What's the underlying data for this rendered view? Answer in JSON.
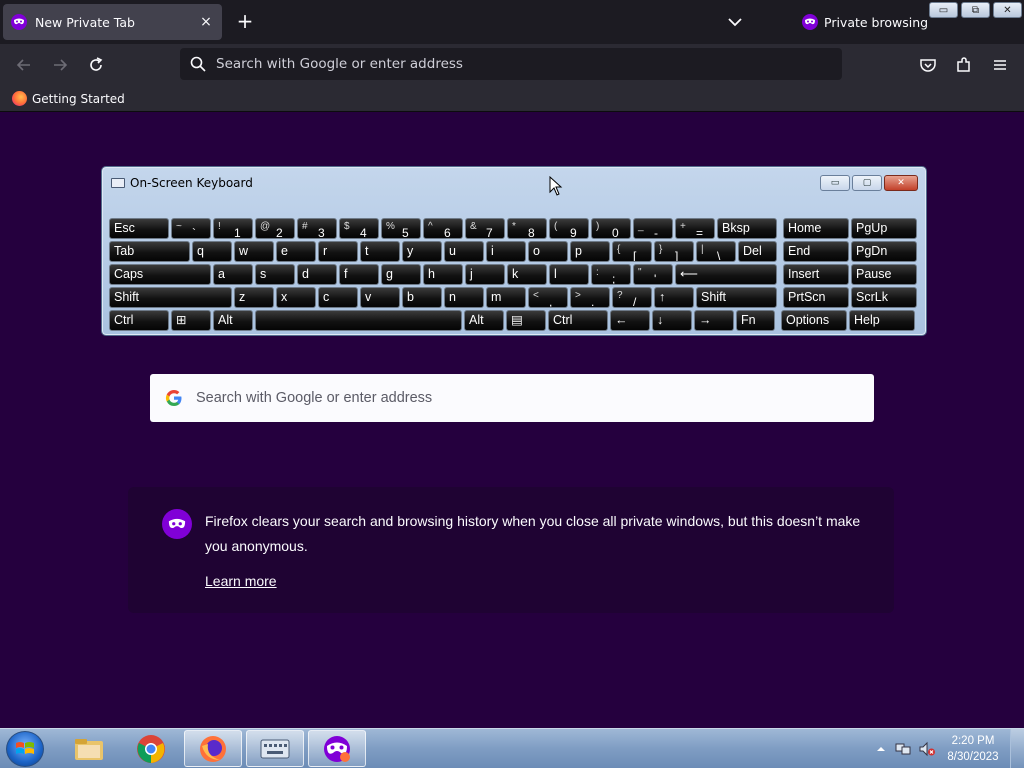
{
  "browser": {
    "tab": {
      "title": "New Private Tab",
      "close": "×"
    },
    "new_tab": "+",
    "private_label": "Private browsing",
    "window_controls": {
      "minimize": "▭",
      "restore": "⧉",
      "close": "✕"
    },
    "urlbar": {
      "placeholder": "Search with Google or enter address"
    },
    "bookmarks": [
      {
        "label": "Getting Started"
      }
    ]
  },
  "osk": {
    "title": "On-Screen Keyboard",
    "controls": {
      "minimize": "▭",
      "maximize": "▢",
      "close": "✕"
    },
    "rows": [
      [
        {
          "t": "",
          "b": "Esc",
          "w": 60
        },
        {
          "t": "~",
          "b": "`",
          "w": 40
        },
        {
          "t": "!",
          "b": "1",
          "w": 40
        },
        {
          "t": "@",
          "b": "2",
          "w": 40
        },
        {
          "t": "#",
          "b": "3",
          "w": 40
        },
        {
          "t": "$",
          "b": "4",
          "w": 40
        },
        {
          "t": "%",
          "b": "5",
          "w": 40
        },
        {
          "t": "^",
          "b": "6",
          "w": 40
        },
        {
          "t": "&",
          "b": "7",
          "w": 40
        },
        {
          "t": "*",
          "b": "8",
          "w": 40
        },
        {
          "t": "(",
          "b": "9",
          "w": 40
        },
        {
          "t": ")",
          "b": "0",
          "w": 40
        },
        {
          "t": "_",
          "b": "-",
          "w": 40
        },
        {
          "t": "+",
          "b": "=",
          "w": 40
        },
        {
          "t": "",
          "b": "Bksp",
          "w": 60
        },
        {
          "t": "",
          "b": "Home",
          "w": 66
        },
        {
          "t": "",
          "b": "PgUp",
          "w": 66
        }
      ],
      [
        {
          "t": "",
          "b": "Tab",
          "w": 81
        },
        {
          "t": "",
          "b": "q",
          "w": 40
        },
        {
          "t": "",
          "b": "w",
          "w": 40
        },
        {
          "t": "",
          "b": "e",
          "w": 40
        },
        {
          "t": "",
          "b": "r",
          "w": 40
        },
        {
          "t": "",
          "b": "t",
          "w": 40
        },
        {
          "t": "",
          "b": "y",
          "w": 40
        },
        {
          "t": "",
          "b": "u",
          "w": 40
        },
        {
          "t": "",
          "b": "i",
          "w": 40
        },
        {
          "t": "",
          "b": "o",
          "w": 40
        },
        {
          "t": "",
          "b": "p",
          "w": 40
        },
        {
          "t": "{",
          "b": "[",
          "w": 40
        },
        {
          "t": "}",
          "b": "]",
          "w": 40
        },
        {
          "t": "|",
          "b": "\\",
          "w": 40
        },
        {
          "t": "",
          "b": "Del",
          "w": 39
        },
        {
          "t": "",
          "b": "End",
          "w": 66
        },
        {
          "t": "",
          "b": "PgDn",
          "w": 66
        }
      ],
      [
        {
          "t": "",
          "b": "Caps",
          "w": 102
        },
        {
          "t": "",
          "b": "a",
          "w": 40
        },
        {
          "t": "",
          "b": "s",
          "w": 40
        },
        {
          "t": "",
          "b": "d",
          "w": 40
        },
        {
          "t": "",
          "b": "f",
          "w": 40
        },
        {
          "t": "",
          "b": "g",
          "w": 40
        },
        {
          "t": "",
          "b": "h",
          "w": 40
        },
        {
          "t": "",
          "b": "j",
          "w": 40
        },
        {
          "t": "",
          "b": "k",
          "w": 40
        },
        {
          "t": "",
          "b": "l",
          "w": 40
        },
        {
          "t": ":",
          "b": ";",
          "w": 40
        },
        {
          "t": "\"",
          "b": "'",
          "w": 40
        },
        {
          "t": "",
          "b": "⟵",
          "w": 102
        },
        {
          "t": "",
          "b": "Insert",
          "w": 66
        },
        {
          "t": "",
          "b": "Pause",
          "w": 66
        }
      ],
      [
        {
          "t": "",
          "b": "Shift",
          "w": 123
        },
        {
          "t": "",
          "b": "z",
          "w": 40
        },
        {
          "t": "",
          "b": "x",
          "w": 40
        },
        {
          "t": "",
          "b": "c",
          "w": 40
        },
        {
          "t": "",
          "b": "v",
          "w": 40
        },
        {
          "t": "",
          "b": "b",
          "w": 40
        },
        {
          "t": "",
          "b": "n",
          "w": 40
        },
        {
          "t": "",
          "b": "m",
          "w": 40
        },
        {
          "t": "<",
          "b": ",",
          "w": 40
        },
        {
          "t": ">",
          "b": ".",
          "w": 40
        },
        {
          "t": "?",
          "b": "/",
          "w": 40
        },
        {
          "t": "",
          "b": "↑",
          "w": 40
        },
        {
          "t": "",
          "b": "Shift",
          "w": 81
        },
        {
          "t": "",
          "b": "PrtScn",
          "w": 66
        },
        {
          "t": "",
          "b": "ScrLk",
          "w": 66
        }
      ],
      [
        {
          "t": "",
          "b": "Ctrl",
          "w": 60
        },
        {
          "t": "",
          "b": "⊞",
          "w": 40
        },
        {
          "t": "",
          "b": "Alt",
          "w": 40
        },
        {
          "t": "",
          "b": "",
          "w": 207
        },
        {
          "t": "",
          "b": "Alt",
          "w": 40
        },
        {
          "t": "",
          "b": "▤",
          "w": 40
        },
        {
          "t": "",
          "b": "Ctrl",
          "w": 60
        },
        {
          "t": "",
          "b": "←",
          "w": 40
        },
        {
          "t": "",
          "b": "↓",
          "w": 40
        },
        {
          "t": "",
          "b": "→",
          "w": 40
        },
        {
          "t": "",
          "b": "Fn",
          "w": 39
        },
        {
          "t": "",
          "b": "Options",
          "w": 66
        },
        {
          "t": "",
          "b": "Help",
          "w": 66
        }
      ]
    ]
  },
  "newtab": {
    "search_placeholder": "Search with Google or enter address",
    "info_message": "Firefox clears your search and browsing history when you close all private windows, but this doesn’t make you anonymous.",
    "learn_more": "Learn more"
  },
  "taskbar": {
    "items": [
      "chrome",
      "firefox",
      "on-screen-keyboard",
      "firefox-private"
    ],
    "time": "2:20 PM",
    "date": "8/30/2023"
  },
  "colors": {
    "page_bg": "#25003e",
    "private_purple": "#8000d7",
    "toolbar": "#2b2a33"
  }
}
